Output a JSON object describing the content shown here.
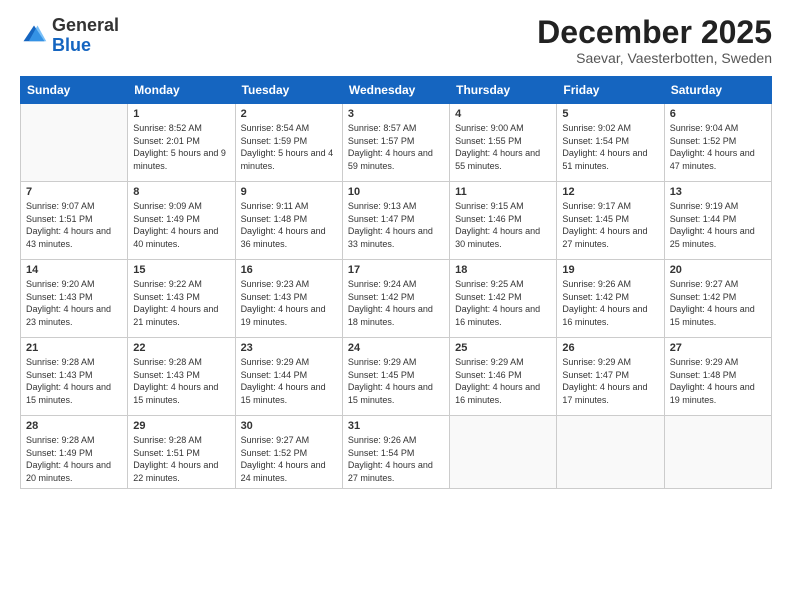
{
  "header": {
    "logo_general": "General",
    "logo_blue": "Blue",
    "month_title": "December 2025",
    "location": "Saevar, Vaesterbotten, Sweden"
  },
  "days_header": [
    "Sunday",
    "Monday",
    "Tuesday",
    "Wednesday",
    "Thursday",
    "Friday",
    "Saturday"
  ],
  "weeks": [
    [
      {
        "day": "",
        "sunrise": "",
        "sunset": "",
        "daylight": ""
      },
      {
        "day": "1",
        "sunrise": "Sunrise: 8:52 AM",
        "sunset": "Sunset: 2:01 PM",
        "daylight": "Daylight: 5 hours and 9 minutes."
      },
      {
        "day": "2",
        "sunrise": "Sunrise: 8:54 AM",
        "sunset": "Sunset: 1:59 PM",
        "daylight": "Daylight: 5 hours and 4 minutes."
      },
      {
        "day": "3",
        "sunrise": "Sunrise: 8:57 AM",
        "sunset": "Sunset: 1:57 PM",
        "daylight": "Daylight: 4 hours and 59 minutes."
      },
      {
        "day": "4",
        "sunrise": "Sunrise: 9:00 AM",
        "sunset": "Sunset: 1:55 PM",
        "daylight": "Daylight: 4 hours and 55 minutes."
      },
      {
        "day": "5",
        "sunrise": "Sunrise: 9:02 AM",
        "sunset": "Sunset: 1:54 PM",
        "daylight": "Daylight: 4 hours and 51 minutes."
      },
      {
        "day": "6",
        "sunrise": "Sunrise: 9:04 AM",
        "sunset": "Sunset: 1:52 PM",
        "daylight": "Daylight: 4 hours and 47 minutes."
      }
    ],
    [
      {
        "day": "7",
        "sunrise": "Sunrise: 9:07 AM",
        "sunset": "Sunset: 1:51 PM",
        "daylight": "Daylight: 4 hours and 43 minutes."
      },
      {
        "day": "8",
        "sunrise": "Sunrise: 9:09 AM",
        "sunset": "Sunset: 1:49 PM",
        "daylight": "Daylight: 4 hours and 40 minutes."
      },
      {
        "day": "9",
        "sunrise": "Sunrise: 9:11 AM",
        "sunset": "Sunset: 1:48 PM",
        "daylight": "Daylight: 4 hours and 36 minutes."
      },
      {
        "day": "10",
        "sunrise": "Sunrise: 9:13 AM",
        "sunset": "Sunset: 1:47 PM",
        "daylight": "Daylight: 4 hours and 33 minutes."
      },
      {
        "day": "11",
        "sunrise": "Sunrise: 9:15 AM",
        "sunset": "Sunset: 1:46 PM",
        "daylight": "Daylight: 4 hours and 30 minutes."
      },
      {
        "day": "12",
        "sunrise": "Sunrise: 9:17 AM",
        "sunset": "Sunset: 1:45 PM",
        "daylight": "Daylight: 4 hours and 27 minutes."
      },
      {
        "day": "13",
        "sunrise": "Sunrise: 9:19 AM",
        "sunset": "Sunset: 1:44 PM",
        "daylight": "Daylight: 4 hours and 25 minutes."
      }
    ],
    [
      {
        "day": "14",
        "sunrise": "Sunrise: 9:20 AM",
        "sunset": "Sunset: 1:43 PM",
        "daylight": "Daylight: 4 hours and 23 minutes."
      },
      {
        "day": "15",
        "sunrise": "Sunrise: 9:22 AM",
        "sunset": "Sunset: 1:43 PM",
        "daylight": "Daylight: 4 hours and 21 minutes."
      },
      {
        "day": "16",
        "sunrise": "Sunrise: 9:23 AM",
        "sunset": "Sunset: 1:43 PM",
        "daylight": "Daylight: 4 hours and 19 minutes."
      },
      {
        "day": "17",
        "sunrise": "Sunrise: 9:24 AM",
        "sunset": "Sunset: 1:42 PM",
        "daylight": "Daylight: 4 hours and 18 minutes."
      },
      {
        "day": "18",
        "sunrise": "Sunrise: 9:25 AM",
        "sunset": "Sunset: 1:42 PM",
        "daylight": "Daylight: 4 hours and 16 minutes."
      },
      {
        "day": "19",
        "sunrise": "Sunrise: 9:26 AM",
        "sunset": "Sunset: 1:42 PM",
        "daylight": "Daylight: 4 hours and 16 minutes."
      },
      {
        "day": "20",
        "sunrise": "Sunrise: 9:27 AM",
        "sunset": "Sunset: 1:42 PM",
        "daylight": "Daylight: 4 hours and 15 minutes."
      }
    ],
    [
      {
        "day": "21",
        "sunrise": "Sunrise: 9:28 AM",
        "sunset": "Sunset: 1:43 PM",
        "daylight": "Daylight: 4 hours and 15 minutes."
      },
      {
        "day": "22",
        "sunrise": "Sunrise: 9:28 AM",
        "sunset": "Sunset: 1:43 PM",
        "daylight": "Daylight: 4 hours and 15 minutes."
      },
      {
        "day": "23",
        "sunrise": "Sunrise: 9:29 AM",
        "sunset": "Sunset: 1:44 PM",
        "daylight": "Daylight: 4 hours and 15 minutes."
      },
      {
        "day": "24",
        "sunrise": "Sunrise: 9:29 AM",
        "sunset": "Sunset: 1:45 PM",
        "daylight": "Daylight: 4 hours and 15 minutes."
      },
      {
        "day": "25",
        "sunrise": "Sunrise: 9:29 AM",
        "sunset": "Sunset: 1:46 PM",
        "daylight": "Daylight: 4 hours and 16 minutes."
      },
      {
        "day": "26",
        "sunrise": "Sunrise: 9:29 AM",
        "sunset": "Sunset: 1:47 PM",
        "daylight": "Daylight: 4 hours and 17 minutes."
      },
      {
        "day": "27",
        "sunrise": "Sunrise: 9:29 AM",
        "sunset": "Sunset: 1:48 PM",
        "daylight": "Daylight: 4 hours and 19 minutes."
      }
    ],
    [
      {
        "day": "28",
        "sunrise": "Sunrise: 9:28 AM",
        "sunset": "Sunset: 1:49 PM",
        "daylight": "Daylight: 4 hours and 20 minutes."
      },
      {
        "day": "29",
        "sunrise": "Sunrise: 9:28 AM",
        "sunset": "Sunset: 1:51 PM",
        "daylight": "Daylight: 4 hours and 22 minutes."
      },
      {
        "day": "30",
        "sunrise": "Sunrise: 9:27 AM",
        "sunset": "Sunset: 1:52 PM",
        "daylight": "Daylight: 4 hours and 24 minutes."
      },
      {
        "day": "31",
        "sunrise": "Sunrise: 9:26 AM",
        "sunset": "Sunset: 1:54 PM",
        "daylight": "Daylight: 4 hours and 27 minutes."
      },
      {
        "day": "",
        "sunrise": "",
        "sunset": "",
        "daylight": ""
      },
      {
        "day": "",
        "sunrise": "",
        "sunset": "",
        "daylight": ""
      },
      {
        "day": "",
        "sunrise": "",
        "sunset": "",
        "daylight": ""
      }
    ]
  ]
}
